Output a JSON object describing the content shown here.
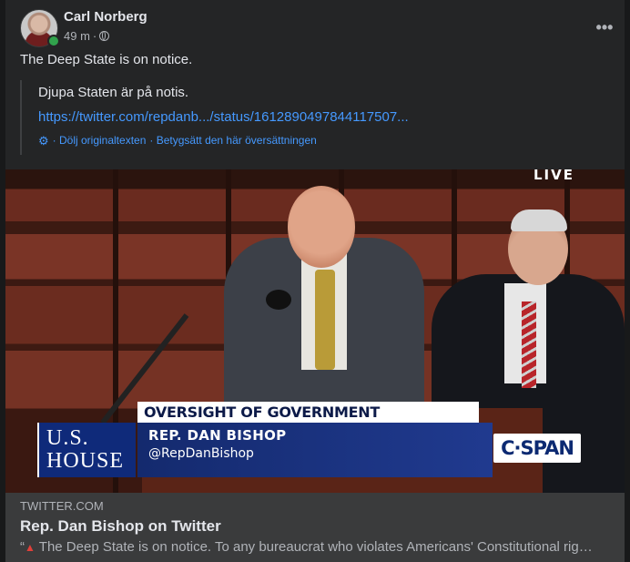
{
  "post": {
    "author": "Carl Norberg",
    "time": "49 m",
    "separator": "·",
    "more_label": "•••",
    "text": "The Deep State is on notice."
  },
  "translation": {
    "text": "Djupa Staten är på notis.",
    "link": "https://twitter.com/repdanb.../status/1612890497844117507...",
    "action_hide": "· Dölj originaltexten",
    "action_rate": "· Betygsätt den här översättningen"
  },
  "video": {
    "live": "LIVE",
    "chyron_headline": "OVERSIGHT OF GOVERNMENT INVESTIGATIONS",
    "chyron_name": "REP. DAN BISHOP",
    "chyron_handle": "@RepDanBishop",
    "house_line1": "U.S.",
    "house_line2": "HOUSE",
    "network_logo": "C·SPAN"
  },
  "card": {
    "domain": "TWITTER.COM",
    "title": "Rep. Dan Bishop on Twitter",
    "quote_mark": "“",
    "description": "The Deep State is on notice. To any bureaucrat who violates Americans' Constitutional rig…"
  },
  "colors": {
    "background": "#18191a",
    "card": "#242526",
    "link": "#4599ff",
    "online": "#31a24c"
  },
  "icons": [
    "globe-icon",
    "more-icon",
    "gear-icon",
    "siren-icon",
    "online-status-icon"
  ]
}
